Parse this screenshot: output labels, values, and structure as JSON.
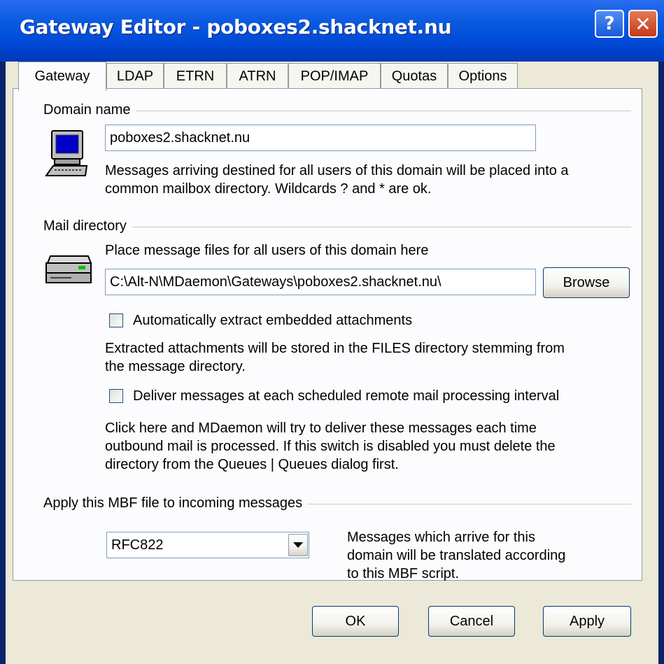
{
  "window": {
    "title": "Gateway Editor - poboxes2.shacknet.nu",
    "help_glyph": "?",
    "close_glyph": "✕"
  },
  "tabs": [
    {
      "label": "Gateway",
      "active": true
    },
    {
      "label": "LDAP"
    },
    {
      "label": "ETRN"
    },
    {
      "label": "ATRN"
    },
    {
      "label": "POP/IMAP"
    },
    {
      "label": "Quotas"
    },
    {
      "label": "Options"
    }
  ],
  "domain": {
    "section_label": "Domain name",
    "value": "poboxes2.shacknet.nu",
    "help_line1": "Messages arriving destined for all users of this domain will be placed into a",
    "help_line2": "common mailbox directory.  Wildcards ? and * are ok.",
    "icon": "computer-icon"
  },
  "mail_dir": {
    "section_label": "Mail directory",
    "caption": "Place message files for all users of this domain here",
    "value": "C:\\Alt-N\\MDaemon\\Gateways\\poboxes2.shacknet.nu\\",
    "browse_label": "Browse",
    "icon": "server-icon",
    "extract_label": "Automatically extract embedded attachments",
    "extract_checked": false,
    "extract_note_line1": "Extracted attachments will be stored in the FILES directory stemming from",
    "extract_note_line2": "the message directory.",
    "deliver_label": "Deliver messages at each scheduled remote mail processing interval",
    "deliver_checked": false,
    "deliver_note_line1": "Click here and MDaemon will try to deliver these messages each time",
    "deliver_note_line2": "outbound mail is processed.  If this switch is disabled you must delete the",
    "deliver_note_line3": "directory from the Queues | Queues dialog first."
  },
  "mbf": {
    "section_label": "Apply this MBF file to incoming messages",
    "selected": "RFC822",
    "note_line1": "Messages which arrive for this",
    "note_line2": "domain will be translated according",
    "note_line3": "to this MBF script."
  },
  "footer": {
    "ok_label": "OK",
    "cancel_label": "Cancel",
    "apply_label": "Apply"
  }
}
